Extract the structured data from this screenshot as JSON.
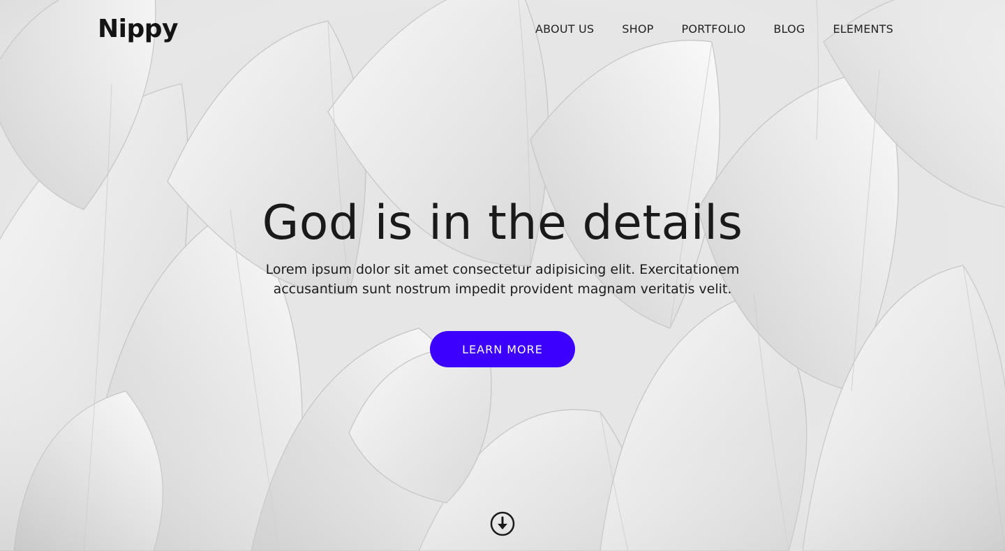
{
  "brand": {
    "name": "Nippy"
  },
  "nav": {
    "items": [
      {
        "label": "ABOUT US"
      },
      {
        "label": "SHOP"
      },
      {
        "label": "PORTFOLIO"
      },
      {
        "label": "BLOG"
      },
      {
        "label": "ELEMENTS"
      }
    ]
  },
  "hero": {
    "headline": "God is in the details",
    "subtext": "Lorem ipsum dolor sit amet consectetur adipisicing elit. Exercitationem accusantium sunt nostrum impedit provident magnam veritatis velit.",
    "cta_label": "LEARN MORE",
    "background_image": "feathers-photo",
    "scroll_icon": "arrow-down-circle-icon"
  },
  "colors": {
    "accent": "#3b00ff",
    "text": "#1a1a1a",
    "button_text": "#ffffff"
  }
}
